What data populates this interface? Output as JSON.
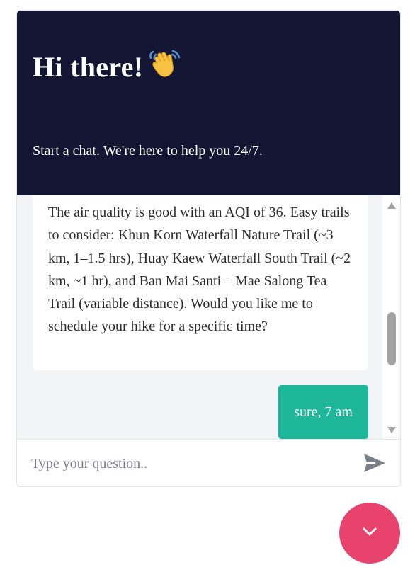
{
  "header": {
    "title": "Hi there!",
    "subtitle": "Start a chat. We're here to help you 24/7.",
    "background": "#121633"
  },
  "messages": [
    {
      "role": "bot",
      "text": "The air quality is good with an AQI of 36. Easy trails to consider: Khun Korn Waterfall Nature Trail (~3 km, 1–1.5 hrs), Huay Kaew Waterfall South Trail (~2 km, ~1 hr), and Ban Mai Santi – Mae Salong Tea Trail (variable distance). Would you like me to schedule your hike for a specific time?"
    },
    {
      "role": "user",
      "text": "sure, 7 am",
      "color": "#1fb79b"
    }
  ],
  "composer": {
    "placeholder": "Type your question..",
    "value": "",
    "send_icon": "send-icon"
  },
  "launcher": {
    "icon": "chevron-down-icon",
    "color": "#e8436d"
  }
}
